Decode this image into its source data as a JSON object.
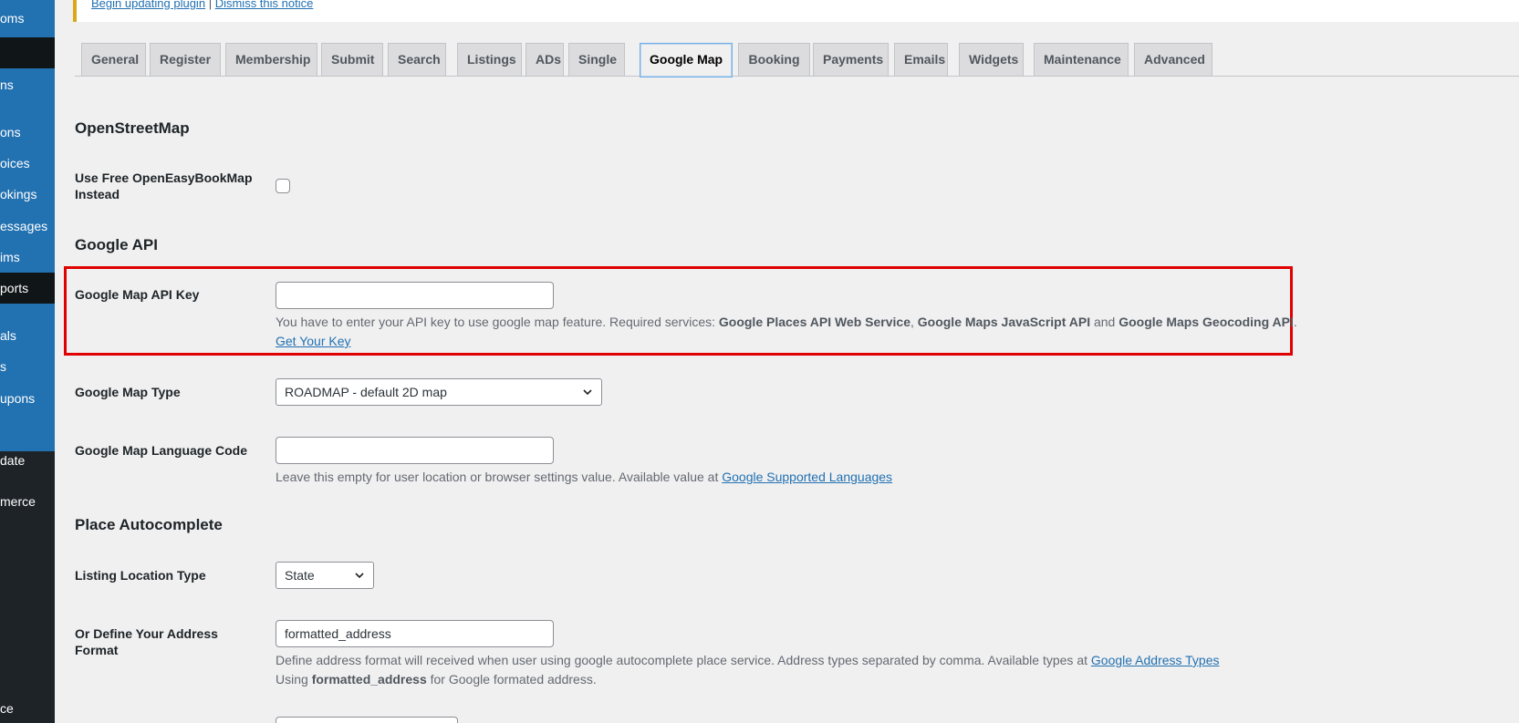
{
  "sidebar": {
    "items": [
      {
        "label": "oms"
      },
      {
        "label": ""
      },
      {
        "label": "ns"
      },
      {
        "label": "ons"
      },
      {
        "label": "oices"
      },
      {
        "label": "okings"
      },
      {
        "label": "essages"
      },
      {
        "label": "ims"
      },
      {
        "label": "ports"
      },
      {
        "label": "als"
      },
      {
        "label": "s"
      },
      {
        "label": "upons"
      },
      {
        "label": "date"
      },
      {
        "label": "merce"
      },
      {
        "label": "ce"
      }
    ]
  },
  "notice": {
    "begin_link": "Begin updating plugin",
    "separator": "|",
    "dismiss_link": "Dismiss this notice"
  },
  "tabs": [
    {
      "label": "General"
    },
    {
      "label": "Register"
    },
    {
      "label": "Membership"
    },
    {
      "label": "Submit"
    },
    {
      "label": "Search"
    },
    {
      "label": "Listings"
    },
    {
      "label": "ADs"
    },
    {
      "label": "Single"
    },
    {
      "label": "Google Map",
      "active": true
    },
    {
      "label": "Booking"
    },
    {
      "label": "Payments"
    },
    {
      "label": "Emails"
    },
    {
      "label": "Widgets"
    },
    {
      "label": "Maintenance"
    },
    {
      "label": "Advanced"
    }
  ],
  "sections": {
    "osm_heading": "OpenStreetMap",
    "google_api_heading": "Google API",
    "autocomplete_heading": "Place Autocomplete"
  },
  "fields": {
    "use_free_map_label": "Use Free OpenEasyBookMap Instead",
    "api_key_label": "Google Map API Key",
    "api_key_value": "",
    "api_key_desc_1": "You have to enter your API key to use google map feature. Required services: ",
    "api_key_svc_1": "Google Places API Web Service",
    "api_key_sep_1": ", ",
    "api_key_svc_2": "Google Maps JavaScript API",
    "api_key_sep_2": " and ",
    "api_key_svc_3": "Google Maps Geocoding API",
    "api_key_desc_end": ".",
    "get_key_link": "Get Your Key",
    "map_type_label": "Google Map Type",
    "map_type_value": "ROADMAP - default 2D map",
    "lang_label": "Google Map Language Code",
    "lang_value": "",
    "lang_desc": "Leave this empty for user location or browser settings value. Available value at ",
    "lang_link": "Google Supported Languages",
    "loc_type_label": "Listing Location Type",
    "loc_type_value": "State",
    "addr_format_label": "Or Define Your Address Format",
    "addr_format_value": "formatted_address",
    "addr_desc_1": "Define address format will received when user using google autocomplete place service. Address types separated by comma. Available types at ",
    "addr_link": "Google Address Types",
    "addr_desc_2a": "Using ",
    "addr_desc_2b": "formatted_address",
    "addr_desc_2c": " for Google formated address."
  },
  "colors": {
    "highlight": "#e00000",
    "sidebar_bg": "#1d2327",
    "sidebar_active": "#2271b1",
    "link": "#2271b1"
  }
}
